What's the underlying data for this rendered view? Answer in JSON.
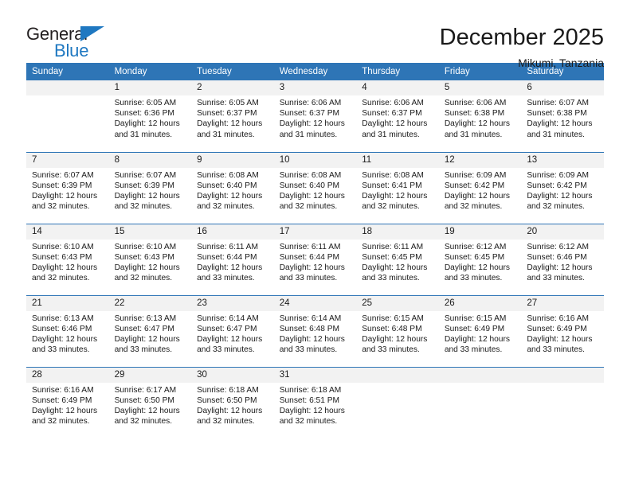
{
  "brand": {
    "name_top": "General",
    "name_bottom": "Blue",
    "accent_color": "#1f78c1"
  },
  "header": {
    "title": "December 2025",
    "subtitle": "Mikumi, Tanzania"
  },
  "theme": {
    "header_row_color": "#2e75b6",
    "daynum_band_color": "#f2f2f2",
    "text_color": "#1a1a1a"
  },
  "calendar": {
    "weekday_headers": [
      "Sunday",
      "Monday",
      "Tuesday",
      "Wednesday",
      "Thursday",
      "Friday",
      "Saturday"
    ],
    "weeks": [
      [
        {
          "day": "",
          "blank": true,
          "sunrise": "",
          "sunset": "",
          "daylight_line1": "",
          "daylight_line2": ""
        },
        {
          "day": "1",
          "sunrise": "Sunrise: 6:05 AM",
          "sunset": "Sunset: 6:36 PM",
          "daylight_line1": "Daylight: 12 hours",
          "daylight_line2": "and 31 minutes."
        },
        {
          "day": "2",
          "sunrise": "Sunrise: 6:05 AM",
          "sunset": "Sunset: 6:37 PM",
          "daylight_line1": "Daylight: 12 hours",
          "daylight_line2": "and 31 minutes."
        },
        {
          "day": "3",
          "sunrise": "Sunrise: 6:06 AM",
          "sunset": "Sunset: 6:37 PM",
          "daylight_line1": "Daylight: 12 hours",
          "daylight_line2": "and 31 minutes."
        },
        {
          "day": "4",
          "sunrise": "Sunrise: 6:06 AM",
          "sunset": "Sunset: 6:37 PM",
          "daylight_line1": "Daylight: 12 hours",
          "daylight_line2": "and 31 minutes."
        },
        {
          "day": "5",
          "sunrise": "Sunrise: 6:06 AM",
          "sunset": "Sunset: 6:38 PM",
          "daylight_line1": "Daylight: 12 hours",
          "daylight_line2": "and 31 minutes."
        },
        {
          "day": "6",
          "sunrise": "Sunrise: 6:07 AM",
          "sunset": "Sunset: 6:38 PM",
          "daylight_line1": "Daylight: 12 hours",
          "daylight_line2": "and 31 minutes."
        }
      ],
      [
        {
          "day": "7",
          "sunrise": "Sunrise: 6:07 AM",
          "sunset": "Sunset: 6:39 PM",
          "daylight_line1": "Daylight: 12 hours",
          "daylight_line2": "and 32 minutes."
        },
        {
          "day": "8",
          "sunrise": "Sunrise: 6:07 AM",
          "sunset": "Sunset: 6:39 PM",
          "daylight_line1": "Daylight: 12 hours",
          "daylight_line2": "and 32 minutes."
        },
        {
          "day": "9",
          "sunrise": "Sunrise: 6:08 AM",
          "sunset": "Sunset: 6:40 PM",
          "daylight_line1": "Daylight: 12 hours",
          "daylight_line2": "and 32 minutes."
        },
        {
          "day": "10",
          "sunrise": "Sunrise: 6:08 AM",
          "sunset": "Sunset: 6:40 PM",
          "daylight_line1": "Daylight: 12 hours",
          "daylight_line2": "and 32 minutes."
        },
        {
          "day": "11",
          "sunrise": "Sunrise: 6:08 AM",
          "sunset": "Sunset: 6:41 PM",
          "daylight_line1": "Daylight: 12 hours",
          "daylight_line2": "and 32 minutes."
        },
        {
          "day": "12",
          "sunrise": "Sunrise: 6:09 AM",
          "sunset": "Sunset: 6:42 PM",
          "daylight_line1": "Daylight: 12 hours",
          "daylight_line2": "and 32 minutes."
        },
        {
          "day": "13",
          "sunrise": "Sunrise: 6:09 AM",
          "sunset": "Sunset: 6:42 PM",
          "daylight_line1": "Daylight: 12 hours",
          "daylight_line2": "and 32 minutes."
        }
      ],
      [
        {
          "day": "14",
          "sunrise": "Sunrise: 6:10 AM",
          "sunset": "Sunset: 6:43 PM",
          "daylight_line1": "Daylight: 12 hours",
          "daylight_line2": "and 32 minutes."
        },
        {
          "day": "15",
          "sunrise": "Sunrise: 6:10 AM",
          "sunset": "Sunset: 6:43 PM",
          "daylight_line1": "Daylight: 12 hours",
          "daylight_line2": "and 32 minutes."
        },
        {
          "day": "16",
          "sunrise": "Sunrise: 6:11 AM",
          "sunset": "Sunset: 6:44 PM",
          "daylight_line1": "Daylight: 12 hours",
          "daylight_line2": "and 33 minutes."
        },
        {
          "day": "17",
          "sunrise": "Sunrise: 6:11 AM",
          "sunset": "Sunset: 6:44 PM",
          "daylight_line1": "Daylight: 12 hours",
          "daylight_line2": "and 33 minutes."
        },
        {
          "day": "18",
          "sunrise": "Sunrise: 6:11 AM",
          "sunset": "Sunset: 6:45 PM",
          "daylight_line1": "Daylight: 12 hours",
          "daylight_line2": "and 33 minutes."
        },
        {
          "day": "19",
          "sunrise": "Sunrise: 6:12 AM",
          "sunset": "Sunset: 6:45 PM",
          "daylight_line1": "Daylight: 12 hours",
          "daylight_line2": "and 33 minutes."
        },
        {
          "day": "20",
          "sunrise": "Sunrise: 6:12 AM",
          "sunset": "Sunset: 6:46 PM",
          "daylight_line1": "Daylight: 12 hours",
          "daylight_line2": "and 33 minutes."
        }
      ],
      [
        {
          "day": "21",
          "sunrise": "Sunrise: 6:13 AM",
          "sunset": "Sunset: 6:46 PM",
          "daylight_line1": "Daylight: 12 hours",
          "daylight_line2": "and 33 minutes."
        },
        {
          "day": "22",
          "sunrise": "Sunrise: 6:13 AM",
          "sunset": "Sunset: 6:47 PM",
          "daylight_line1": "Daylight: 12 hours",
          "daylight_line2": "and 33 minutes."
        },
        {
          "day": "23",
          "sunrise": "Sunrise: 6:14 AM",
          "sunset": "Sunset: 6:47 PM",
          "daylight_line1": "Daylight: 12 hours",
          "daylight_line2": "and 33 minutes."
        },
        {
          "day": "24",
          "sunrise": "Sunrise: 6:14 AM",
          "sunset": "Sunset: 6:48 PM",
          "daylight_line1": "Daylight: 12 hours",
          "daylight_line2": "and 33 minutes."
        },
        {
          "day": "25",
          "sunrise": "Sunrise: 6:15 AM",
          "sunset": "Sunset: 6:48 PM",
          "daylight_line1": "Daylight: 12 hours",
          "daylight_line2": "and 33 minutes."
        },
        {
          "day": "26",
          "sunrise": "Sunrise: 6:15 AM",
          "sunset": "Sunset: 6:49 PM",
          "daylight_line1": "Daylight: 12 hours",
          "daylight_line2": "and 33 minutes."
        },
        {
          "day": "27",
          "sunrise": "Sunrise: 6:16 AM",
          "sunset": "Sunset: 6:49 PM",
          "daylight_line1": "Daylight: 12 hours",
          "daylight_line2": "and 33 minutes."
        }
      ],
      [
        {
          "day": "28",
          "sunrise": "Sunrise: 6:16 AM",
          "sunset": "Sunset: 6:49 PM",
          "daylight_line1": "Daylight: 12 hours",
          "daylight_line2": "and 32 minutes."
        },
        {
          "day": "29",
          "sunrise": "Sunrise: 6:17 AM",
          "sunset": "Sunset: 6:50 PM",
          "daylight_line1": "Daylight: 12 hours",
          "daylight_line2": "and 32 minutes."
        },
        {
          "day": "30",
          "sunrise": "Sunrise: 6:18 AM",
          "sunset": "Sunset: 6:50 PM",
          "daylight_line1": "Daylight: 12 hours",
          "daylight_line2": "and 32 minutes."
        },
        {
          "day": "31",
          "sunrise": "Sunrise: 6:18 AM",
          "sunset": "Sunset: 6:51 PM",
          "daylight_line1": "Daylight: 12 hours",
          "daylight_line2": "and 32 minutes."
        },
        {
          "day": "",
          "blank": true,
          "sunrise": "",
          "sunset": "",
          "daylight_line1": "",
          "daylight_line2": ""
        },
        {
          "day": "",
          "blank": true,
          "sunrise": "",
          "sunset": "",
          "daylight_line1": "",
          "daylight_line2": ""
        },
        {
          "day": "",
          "blank": true,
          "sunrise": "",
          "sunset": "",
          "daylight_line1": "",
          "daylight_line2": ""
        }
      ]
    ]
  }
}
